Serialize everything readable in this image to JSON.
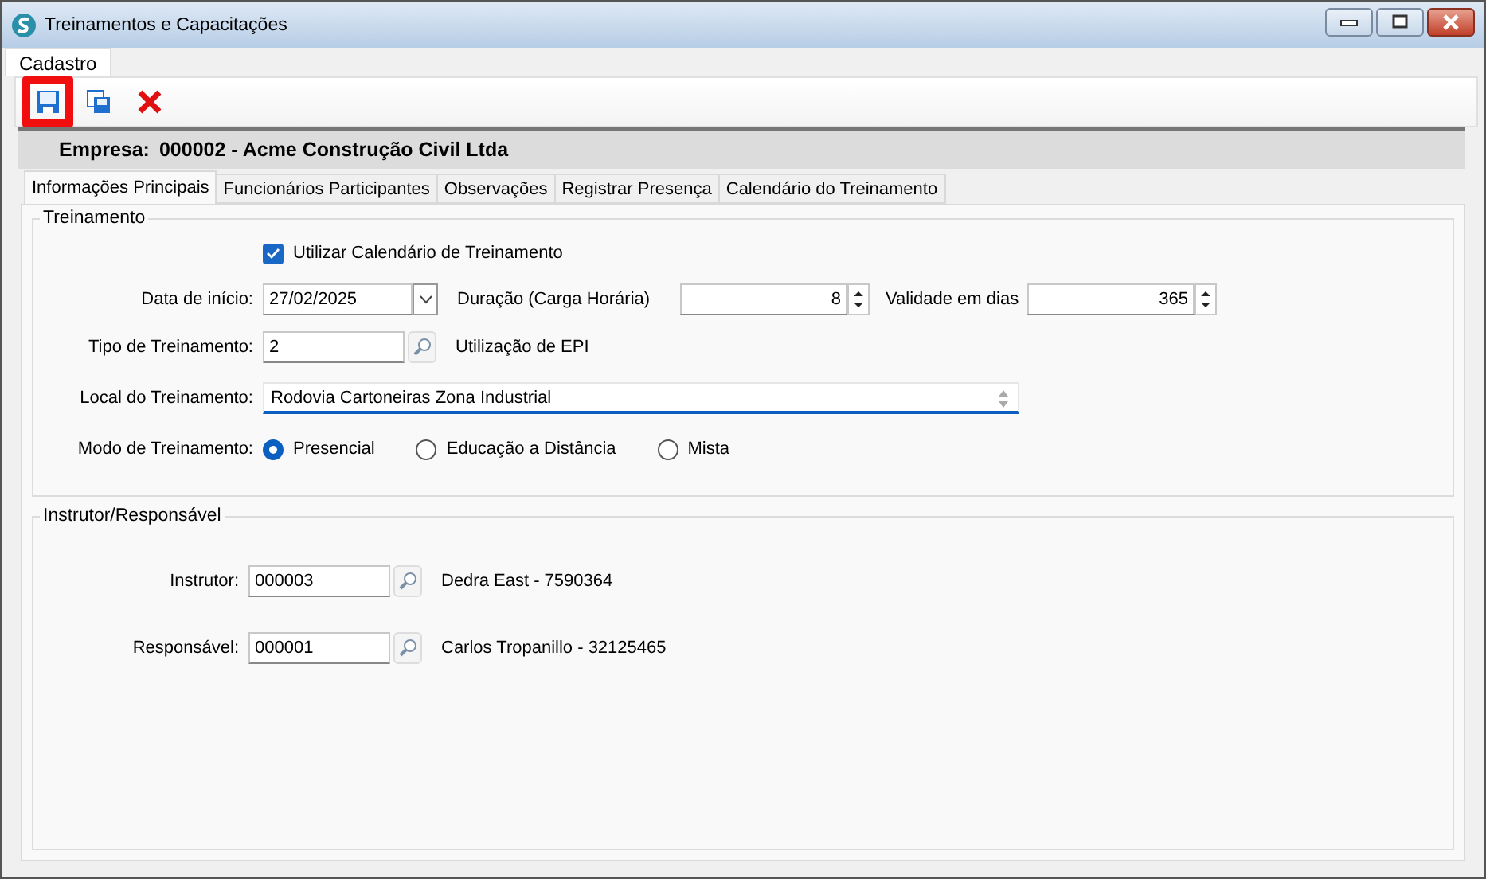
{
  "window": {
    "title": "Treinamentos e Capacitações"
  },
  "menu": [
    {
      "label": "Cadastro",
      "selected": true
    }
  ],
  "toolbar": [
    {
      "kind": "save",
      "highlighted": true
    },
    {
      "kind": "copy",
      "highlighted": false
    },
    {
      "kind": "cancel",
      "highlighted": false
    }
  ],
  "company": {
    "label": "Empresa:",
    "value": "000002 - Acme Construção Civil Ltda"
  },
  "tabs": [
    {
      "label": "Informações Principais",
      "selected": true
    },
    {
      "label": "Funcionários Participantes",
      "selected": false
    },
    {
      "label": "Observações",
      "selected": false
    },
    {
      "label": "Registrar Presença",
      "selected": false
    },
    {
      "label": "Calendário do Treinamento",
      "selected": false
    }
  ],
  "training": {
    "title": "Treinamento",
    "use_calendar": {
      "label": "Utilizar Calendário de Treinamento",
      "checked": true
    },
    "start_date": {
      "label": "Data de início:",
      "value": "27/02/2025"
    },
    "duration": {
      "label": "Duração (Carga Horária)",
      "value": "8"
    },
    "validity": {
      "label": "Validade em dias",
      "value": "365"
    },
    "type": {
      "label": "Tipo de Treinamento:",
      "value": "2",
      "description": "Utilização de EPI"
    },
    "location": {
      "label": "Local do Treinamento:",
      "value": "Rodovia Cartoneiras Zona Industrial"
    },
    "mode": {
      "label": "Modo de Treinamento:",
      "options": [
        {
          "label": "Presencial",
          "selected": true
        },
        {
          "label": "Educação a Distância",
          "selected": false
        },
        {
          "label": "Mista",
          "selected": false
        }
      ]
    }
  },
  "people": {
    "title": "Instrutor/Responsável",
    "rows": [
      {
        "label": "Instrutor:",
        "value": "000003",
        "description": "Dedra East - 7590364"
      },
      {
        "label": "Responsável:",
        "value": "000001",
        "description": "Carlos Tropanillo - 32125465"
      }
    ]
  }
}
